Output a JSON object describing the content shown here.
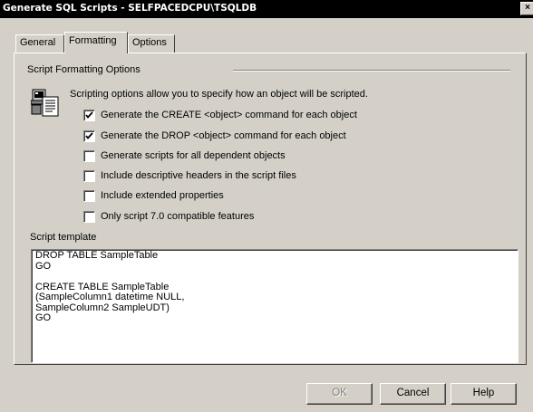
{
  "window": {
    "title": "Generate SQL Scripts - SELFPACEDCPU\\TSQLDB",
    "close_glyph": "×"
  },
  "tabs": [
    {
      "label": "General",
      "active": false
    },
    {
      "label": "Formatting",
      "active": true
    },
    {
      "label": "Options",
      "active": false
    }
  ],
  "formatting": {
    "group_label": "Script Formatting Options",
    "description": "Scripting options allow you to specify how an object will be scripted.",
    "icon": "script-document-icon",
    "options": [
      {
        "label": "Generate the CREATE <object> command for each object",
        "checked": true
      },
      {
        "label": "Generate the DROP <object> command for each object",
        "checked": true
      },
      {
        "label": "Generate scripts for all dependent objects",
        "checked": false
      },
      {
        "label": "Include descriptive headers in the script files",
        "checked": false
      },
      {
        "label": "Include extended properties",
        "checked": false
      },
      {
        "label": "Only script 7.0 compatible features",
        "checked": false
      }
    ],
    "template_label": "Script template",
    "template_lines": [
      "DROP TABLE SampleTable",
      "GO",
      "",
      "CREATE TABLE SampleTable",
      "(SampleColumn1 datetime NULL,",
      "SampleColumn2 SampleUDT)",
      "GO"
    ]
  },
  "buttons": {
    "ok": "OK",
    "cancel": "Cancel",
    "help": "Help"
  }
}
